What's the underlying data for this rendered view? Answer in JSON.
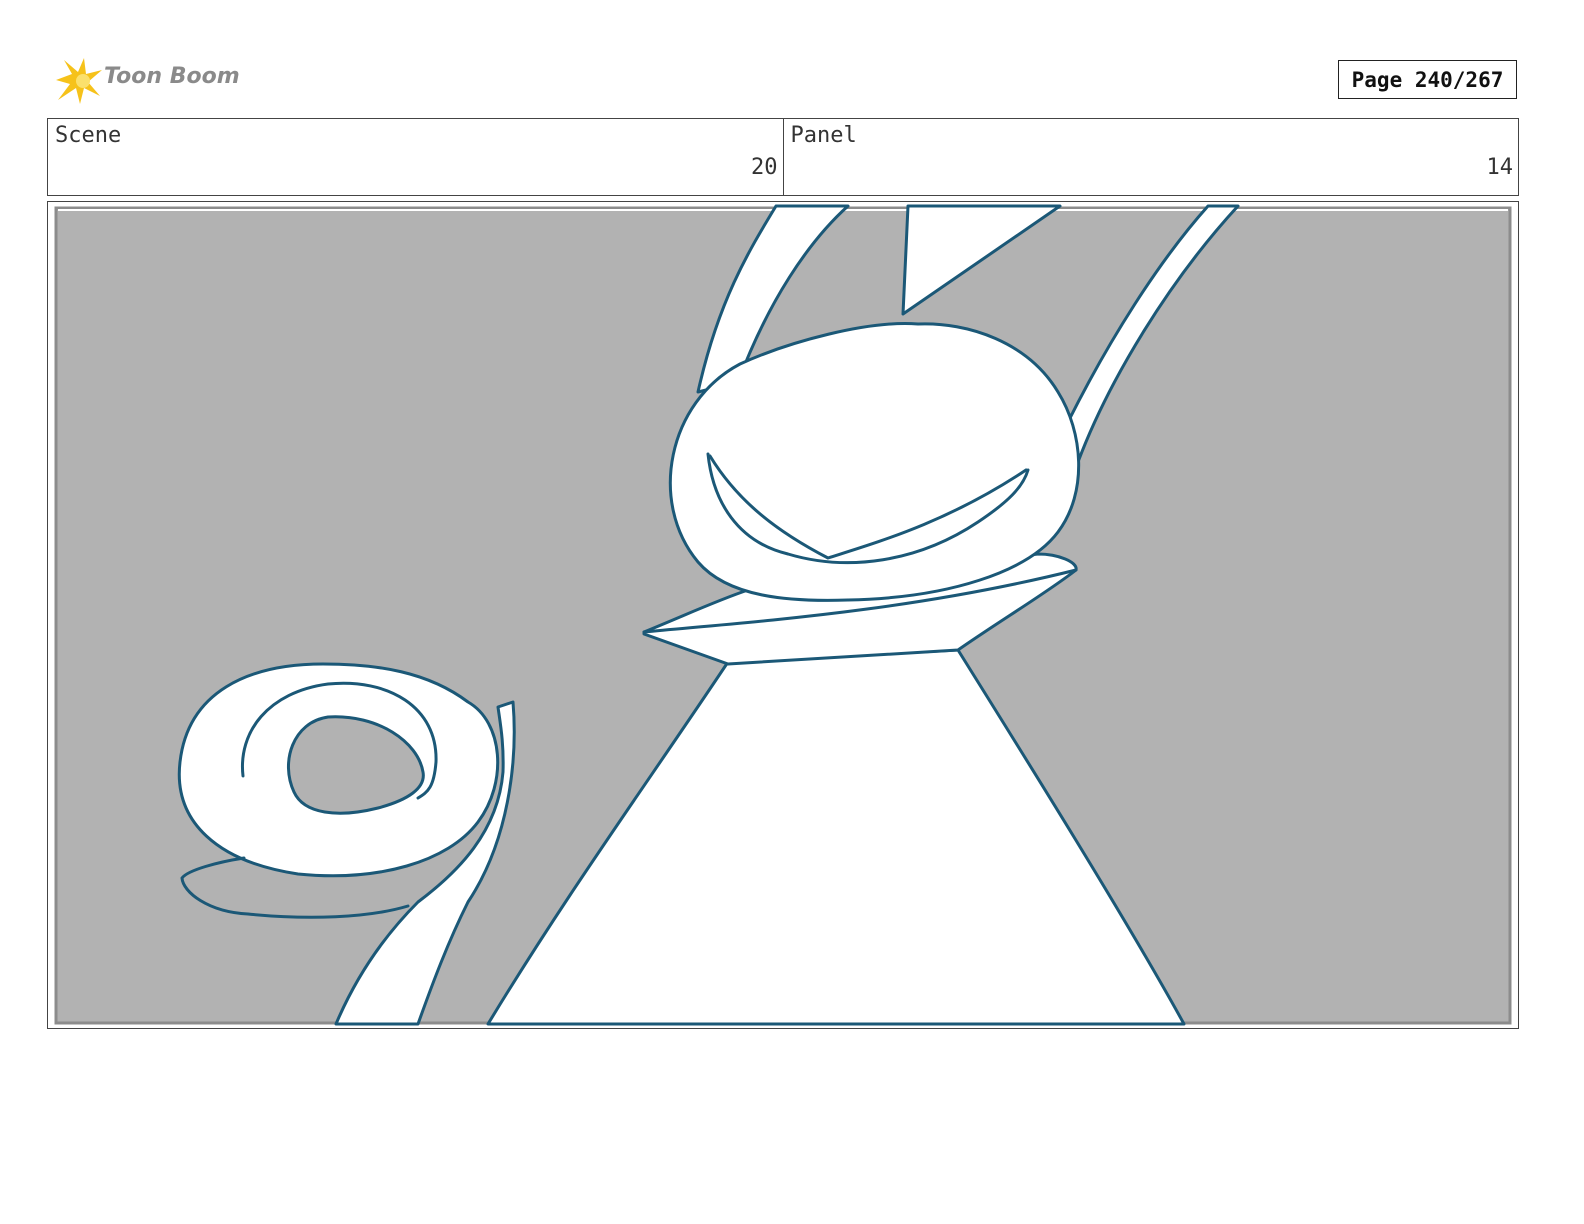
{
  "header": {
    "logo_text": "Toon Boom",
    "page_label": "Page 240/267"
  },
  "info": {
    "scene_label": "Scene",
    "scene_value": "20",
    "panel_label": "Panel",
    "panel_value": "14"
  },
  "colors": {
    "background_gray": "#b2b2b2",
    "sketch_line": "#1b5877",
    "logo_star": "#f6c21a"
  },
  "icons": {
    "logo": "toon-boom-star-icon"
  }
}
